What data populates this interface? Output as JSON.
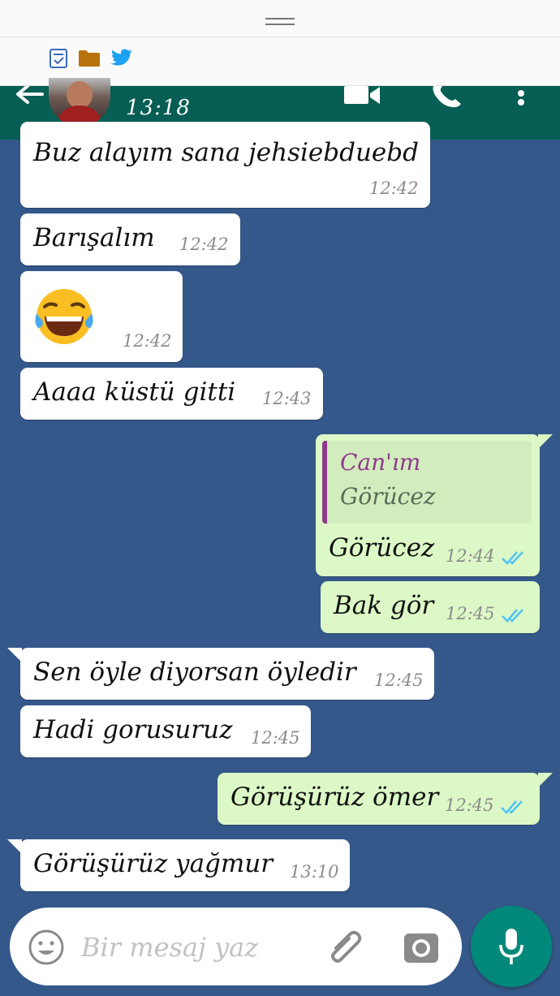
{
  "header": {
    "time": "13:18"
  },
  "messages": [
    {
      "text": "Buz alayım sana jehsiebduebd",
      "time": "12:42"
    },
    {
      "text": "Barışalım",
      "time": "12:42"
    },
    {
      "emoji": "😂",
      "time": "12:42"
    },
    {
      "text": "Aaaa küstü gitti",
      "time": "12:43"
    },
    {
      "quote": {
        "name": "Can'ım",
        "text": "Görücez"
      },
      "text": "Görücez",
      "time": "12:44"
    },
    {
      "text": "Bak gör",
      "time": "12:45"
    },
    {
      "text": "Sen öyle diyorsan öyledir",
      "time": "12:45"
    },
    {
      "text": "Hadi gorusuruz",
      "time": "12:45"
    },
    {
      "text": "Görüşürüz ömer",
      "time": "12:45"
    },
    {
      "text": "Görüşürüz yağmur",
      "time": "13:10"
    }
  ],
  "composer": {
    "placeholder": "Bir mesaj yaz"
  },
  "colors": {
    "header": "#075e54",
    "incoming": "#ffffff",
    "outgoing": "#dcf8c6",
    "background": "#35588a",
    "ticks": "#4fc3f7",
    "mic": "#00897b",
    "quote_accent": "#8e3a8c"
  },
  "icons": [
    "task-icon",
    "folder-icon",
    "twitter-icon",
    "back-arrow-icon",
    "video-call-icon",
    "phone-icon",
    "more-vert-icon",
    "emoji-icon",
    "attach-icon",
    "camera-icon",
    "mic-icon",
    "double-check-icon"
  ]
}
